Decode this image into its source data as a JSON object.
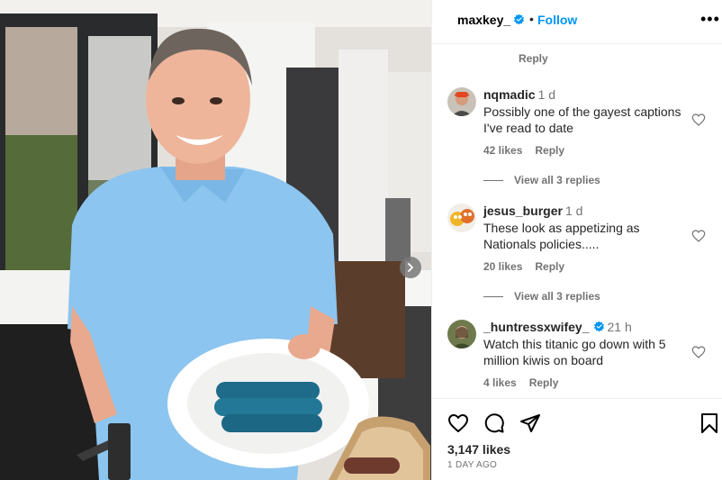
{
  "post": {
    "username": "maxkey_",
    "separator": "•",
    "follow_label": "Follow",
    "more_label": "•••",
    "likes_count": "3,147 likes",
    "date": "1 DAY AGO"
  },
  "comments_panel": {
    "top_reply_label": "Reply",
    "comments": [
      {
        "username": "nqmadic",
        "time": "1 d",
        "verified": false,
        "text": "Possibly one of the gayest captions I've read to date",
        "likes": "42 likes",
        "reply_label": "Reply",
        "view_replies": "View all 3 replies"
      },
      {
        "username": "jesus_burger",
        "time": "1 d",
        "verified": false,
        "text": "These look as appetizing as Nationals policies.....",
        "likes": "20 likes",
        "reply_label": "Reply",
        "view_replies": "View all 3 replies"
      },
      {
        "username": "_huntressxwifey_",
        "time": "21 h",
        "verified": true,
        "text": "Watch this titanic go down with 5 million kiwis on board",
        "likes": "4 likes",
        "reply_label": "Reply"
      }
    ]
  },
  "icons": {
    "verified": "verified-badge-icon",
    "heart": "heart-icon",
    "comment": "comment-icon",
    "share": "share-icon",
    "save": "bookmark-icon",
    "next": "chevron-right-icon",
    "more": "more-options-icon"
  },
  "colors": {
    "accent_blue": "#0095f6",
    "secondary_text": "#737373",
    "divider": "#efefef"
  }
}
